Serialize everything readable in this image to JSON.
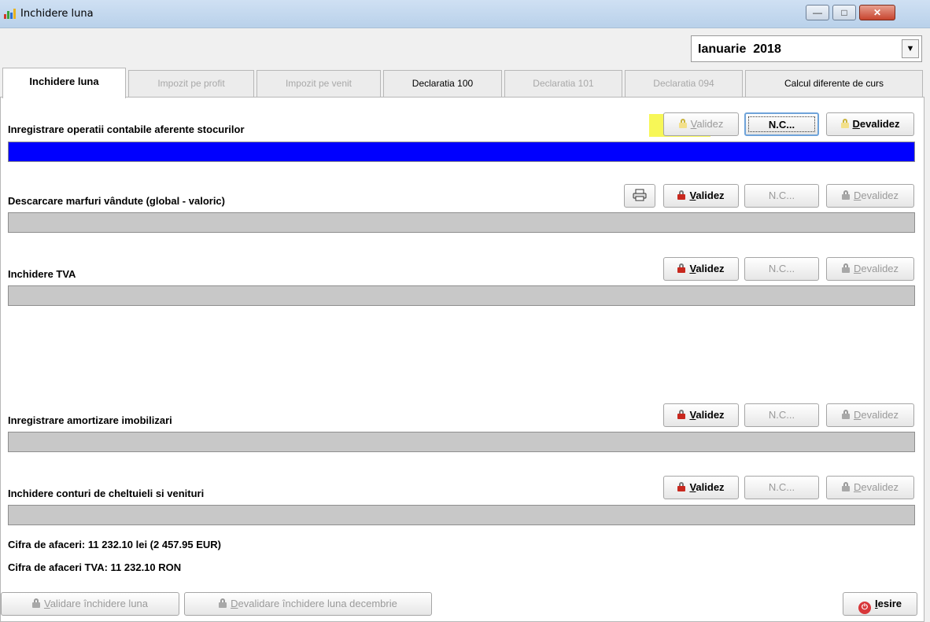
{
  "window": {
    "title": "Inchidere luna"
  },
  "period": {
    "month_label": "Ianuarie  2018"
  },
  "tabs": [
    {
      "label": "Inchidere luna"
    },
    {
      "label": "Impozit pe profit"
    },
    {
      "label": "Impozit pe venit"
    },
    {
      "label": "Declaratia 100"
    },
    {
      "label": "Declaratia 101"
    },
    {
      "label": "Declaratia 094"
    },
    {
      "label": "Calcul diferente de curs"
    }
  ],
  "sections": [
    {
      "label": "Inregistrare operatii contabile aferente stocurilor",
      "progress": 1.0
    },
    {
      "label": "Descarcare marfuri vândute (global - valoric)",
      "progress": 0
    },
    {
      "label": "Inchidere TVA",
      "progress": 0
    },
    {
      "label": "Inregistrare amortizare imobilizari",
      "progress": 0
    },
    {
      "label": "Inchidere conturi de cheltuieli si venituri",
      "progress": 0
    }
  ],
  "buttons": {
    "validez_key": "V",
    "validez_rest": "alidez",
    "nc": "N.C...",
    "devalidez_key": "D",
    "devalidez_rest": "evalidez"
  },
  "summary": {
    "cifra_afaceri": "Cifra de afaceri: 11 232.10 lei (2 457.95 EUR)",
    "cifra_afaceri_tva": "Cifra de afaceri TVA: 11 232.10 RON"
  },
  "footer": {
    "validare_key": "V",
    "validare_rest": "alidare închidere luna",
    "devalidare_key": "D",
    "devalidare_rest": "evalidare închidere luna decembrie",
    "iesire_key": "I",
    "iesire_rest": "esire"
  },
  "colors": {
    "progress_fill": "#0000ff",
    "highlight": "#f6f63a",
    "title_bar": "#b9d1ea"
  }
}
